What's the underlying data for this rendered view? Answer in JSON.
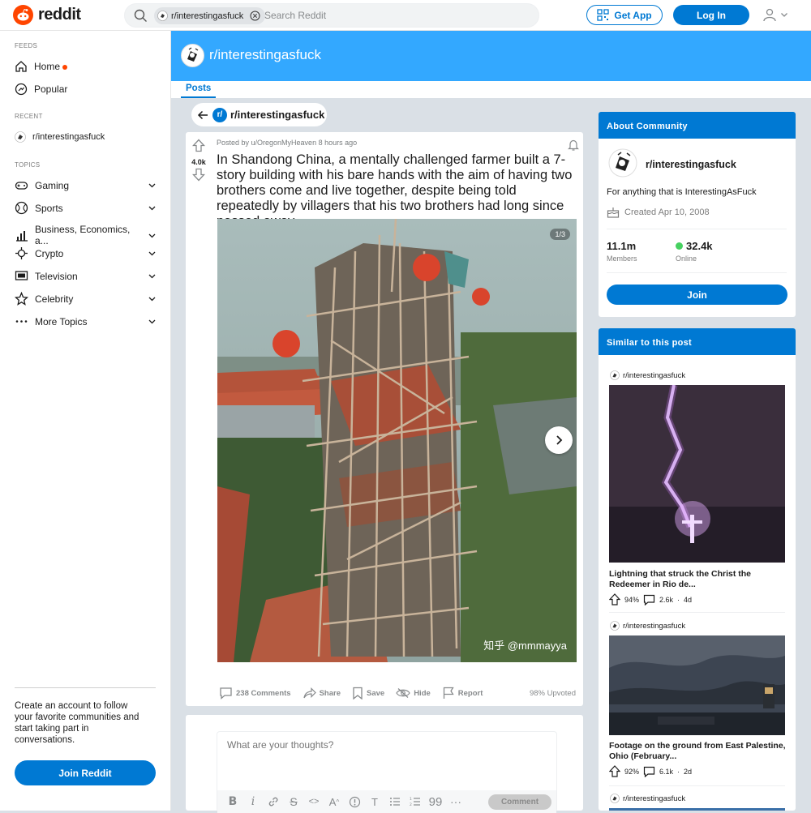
{
  "header": {
    "brand": "reddit",
    "search_chip": "r/interestingasfuck",
    "search_placeholder": "Search Reddit",
    "get_app": "Get App",
    "login": "Log In"
  },
  "sidebar": {
    "feeds_title": "FEEDS",
    "home": "Home",
    "popular": "Popular",
    "recent_title": "RECENT",
    "recent_item": "r/interestingasfuck",
    "topics_title": "TOPICS",
    "topics": [
      {
        "label": "Gaming",
        "icon": "gamepad-icon"
      },
      {
        "label": "Sports",
        "icon": "sports-ball-icon"
      },
      {
        "label": "Business, Economics, a...",
        "icon": "chart-icon"
      },
      {
        "label": "Crypto",
        "icon": "crypto-icon"
      },
      {
        "label": "Television",
        "icon": "television-icon"
      },
      {
        "label": "Celebrity",
        "icon": "star-icon"
      },
      {
        "label": "More Topics",
        "icon": "more-dots-icon"
      }
    ],
    "cta": "Create an account to follow your favorite communities and start taking part in conversations.",
    "join": "Join Reddit"
  },
  "community": {
    "name": "r/interestingasfuck",
    "tab": "Posts",
    "back_label": "r/interestingasfuck"
  },
  "post": {
    "score": "4.0k",
    "meta": "Posted by u/OregonMyHeaven 8 hours ago",
    "title": "In Shandong China, a mentally challenged farmer built a 7-story building with his bare hands with the aim of having two brothers come and live together, despite being told repeatedly by villagers that his two brothers had long since passed away.",
    "gallery_counter": "1/3",
    "watermark": "知乎 @mmmayya",
    "comments": "238 Comments",
    "share": "Share",
    "save": "Save",
    "hide": "Hide",
    "report": "Report",
    "upvoted": "98% Upvoted",
    "upvote_ratio": 0.98
  },
  "comment_box": {
    "placeholder": "What are your thoughts?",
    "button": "Comment"
  },
  "about": {
    "title": "About Community",
    "name": "r/interestingasfuck",
    "description": "For anything that is InterestingAsFuck",
    "created": "Created Apr 10, 2008",
    "members": "11.1m",
    "members_label": "Members",
    "online": "32.4k",
    "online_label": "Online",
    "join": "Join"
  },
  "similar": {
    "title": "Similar to this post",
    "items": [
      {
        "sub": "r/interestingasfuck",
        "title": "Lightning that struck the Christ the Redeemer in Rio de...",
        "upvote": "94%",
        "comments": "2.6k",
        "age": "4d"
      },
      {
        "sub": "r/interestingasfuck",
        "title": "Footage on the ground from East Palestine, Ohio (February...",
        "upvote": "92%",
        "comments": "6.1k",
        "age": "2d"
      },
      {
        "sub": "r/interestingasfuck"
      }
    ]
  },
  "colors": {
    "accent": "#0079d3",
    "banner": "#33a8ff",
    "brand_orange": "#ff4500",
    "online_green": "#46d160"
  }
}
